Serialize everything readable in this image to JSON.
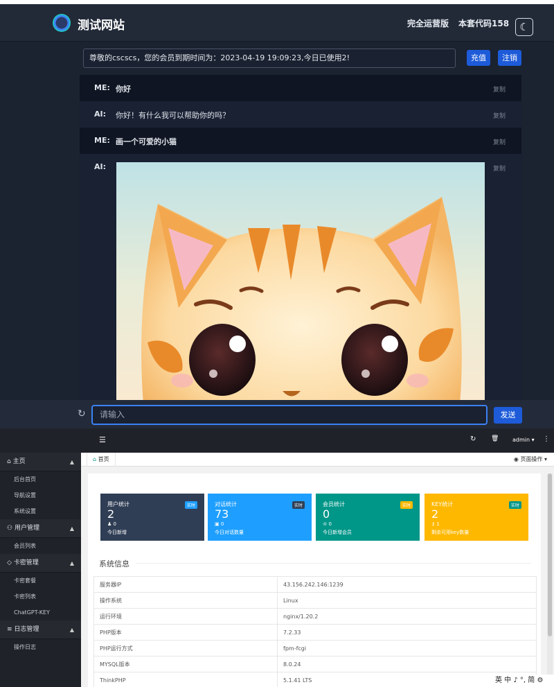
{
  "chat_app": {
    "site_title": "测试网站",
    "edition": "完全运营版",
    "code": "本套代码158",
    "notice": "尊敬的cscscs，您的会员到期时间为：2023-04-19 19:09:23,今日已使用2!",
    "recharge_label": "充值",
    "logout_label": "注销",
    "messages": [
      {
        "who": "ME:",
        "text": "你好",
        "copy": "复制"
      },
      {
        "who": "AI:",
        "text": "你好！有什么我可以帮助你的吗？",
        "copy": "复制"
      },
      {
        "who": "ME:",
        "text": "画一个可爱的小猫",
        "copy": "复制"
      },
      {
        "who": "AI:",
        "text": "",
        "copy": "复制"
      }
    ],
    "input_placeholder": "请输入",
    "send_label": "发送"
  },
  "admin": {
    "user": "admin ▾",
    "sidebar": [
      {
        "label": "主页",
        "items": [
          "后台首页",
          "导航设置",
          "系统设置"
        ]
      },
      {
        "label": "用户管理",
        "items": [
          "会员列表"
        ]
      },
      {
        "label": "卡密管理",
        "items": [
          "卡密套餐",
          "卡密列表",
          "ChatGPT-KEY"
        ]
      },
      {
        "label": "日志管理",
        "items": [
          "操作日志"
        ]
      }
    ],
    "home_tab": "首页",
    "page_ops": "页面操作",
    "cards": [
      {
        "title": "用户统计",
        "badge": "实时",
        "value": "2",
        "sub": "0",
        "desc": "今日新增",
        "color": "#2f3e55",
        "badge_color": "#1e9fff"
      },
      {
        "title": "对话统计",
        "badge": "实时",
        "value": "73",
        "sub": "0",
        "desc": "今日对话数量",
        "color": "#1e9fff",
        "badge_color": "#2f4056"
      },
      {
        "title": "会员统计",
        "badge": "实时",
        "value": "0",
        "sub": "0",
        "desc": "今日新增会员",
        "color": "#009688",
        "badge_color": "#ffb800"
      },
      {
        "title": "KEY统计",
        "badge": "实时",
        "value": "2",
        "sub": "1",
        "desc": "剩余可用key数量",
        "color": "#ffb800",
        "badge_color": "#009688"
      }
    ],
    "sys_title": "系统信息",
    "sys_rows": [
      [
        "服务器IP",
        "43.156.242.146:1239"
      ],
      [
        "操作系统",
        "Linux"
      ],
      [
        "运行环境",
        "nginx/1.20.2"
      ],
      [
        "PHP版本",
        "7.2.33"
      ],
      [
        "PHP运行方式",
        "fpm-fcgi"
      ],
      [
        "MYSQL版本",
        "8.0.24"
      ],
      [
        "ThinkPHP",
        "5.1.41 LTS"
      ]
    ]
  },
  "taskbar": "英 中 ♪ °, 简 ⚙"
}
